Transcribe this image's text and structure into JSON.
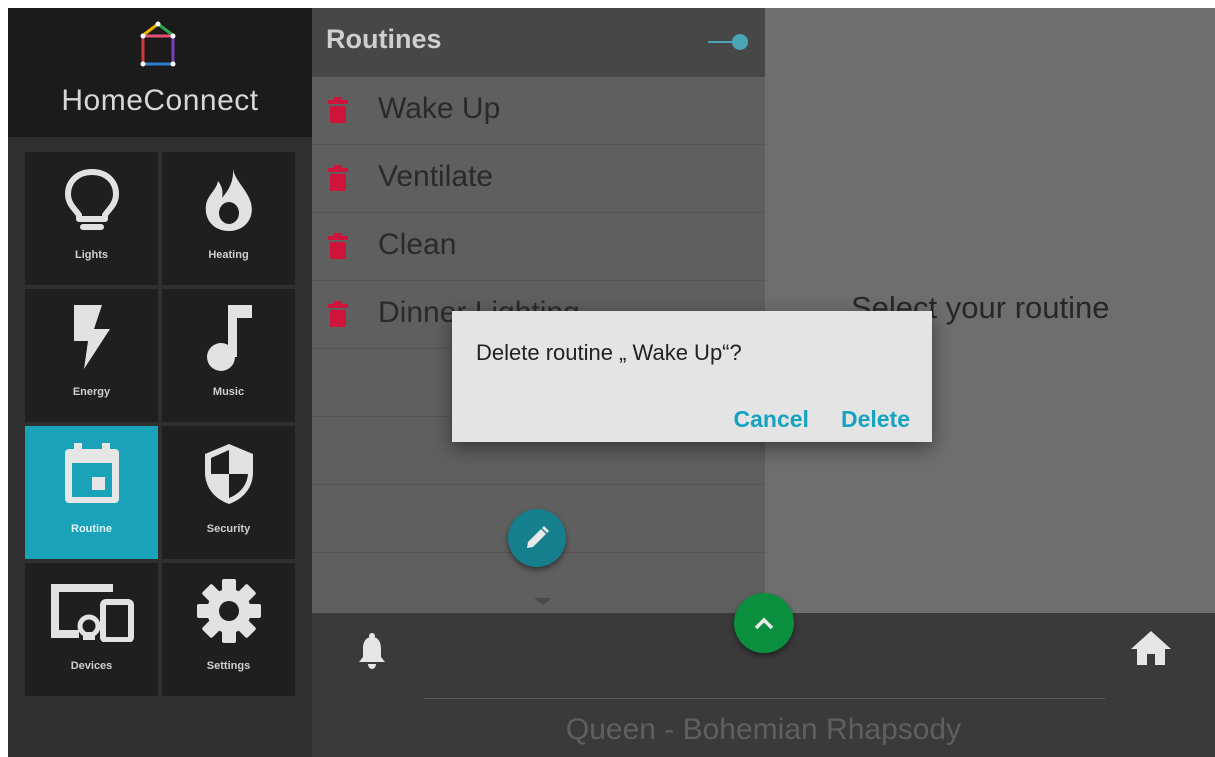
{
  "app": {
    "name": "HomeConnect"
  },
  "sidebar": {
    "tiles": [
      {
        "label": "Lights",
        "icon": "bulb-icon"
      },
      {
        "label": "Heating",
        "icon": "flame-icon"
      },
      {
        "label": "Energy",
        "icon": "bolt-icon"
      },
      {
        "label": "Music",
        "icon": "music-note-icon"
      },
      {
        "label": "Routine",
        "icon": "calendar-icon",
        "active": true
      },
      {
        "label": "Security",
        "icon": "shield-icon"
      },
      {
        "label": "Devices",
        "icon": "devices-icon"
      },
      {
        "label": "Settings",
        "icon": "gear-icon"
      }
    ]
  },
  "panel": {
    "title": "Routines",
    "toggle_on": true,
    "routines": [
      {
        "label": "Wake Up"
      },
      {
        "label": "Ventilate"
      },
      {
        "label": "Clean"
      },
      {
        "label": "Dinner Lighting"
      }
    ]
  },
  "content": {
    "message": "Select your routine"
  },
  "dialog": {
    "message": "Delete routine „ Wake Up“?",
    "cancel_label": "Cancel",
    "delete_label": "Delete"
  },
  "player": {
    "track": "Queen - Bohemian Rhapsody"
  },
  "colors": {
    "accent": "#1aa3b8",
    "delete": "#d0133a",
    "fab_green": "#0a8f3f",
    "dialog_action": "#16a3bf"
  }
}
